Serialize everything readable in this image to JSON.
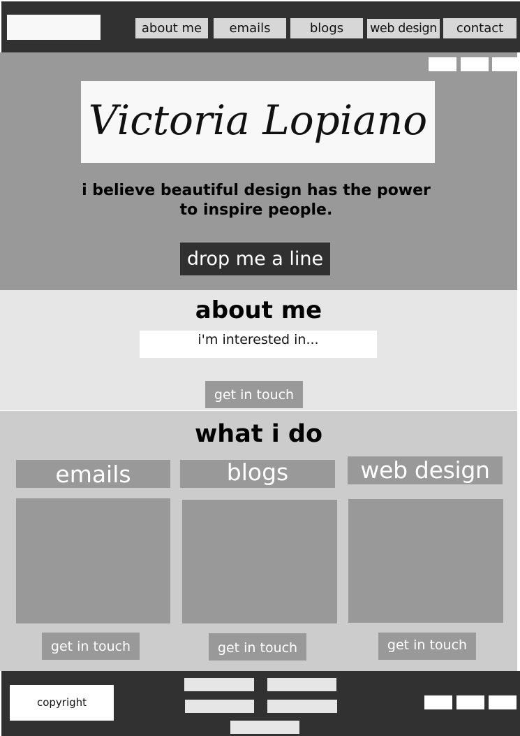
{
  "header": {
    "nav": [
      "about me",
      "emails",
      "blogs",
      "web design",
      "contact"
    ]
  },
  "hero": {
    "name": "Victoria Lopiano",
    "tagline_line1": "i believe beautiful design has the power",
    "tagline_line2": "to inspire people.",
    "cta": "drop me a line"
  },
  "about": {
    "title": "about me",
    "interest": "i'm interested in...",
    "button": "get in touch"
  },
  "services": {
    "title": "what i do",
    "items": [
      {
        "title": "emails",
        "button": "get in touch"
      },
      {
        "title": "blogs",
        "button": "get in touch"
      },
      {
        "title": "web design",
        "button": "get in touch"
      }
    ]
  },
  "footer": {
    "copyright": "copyright"
  }
}
